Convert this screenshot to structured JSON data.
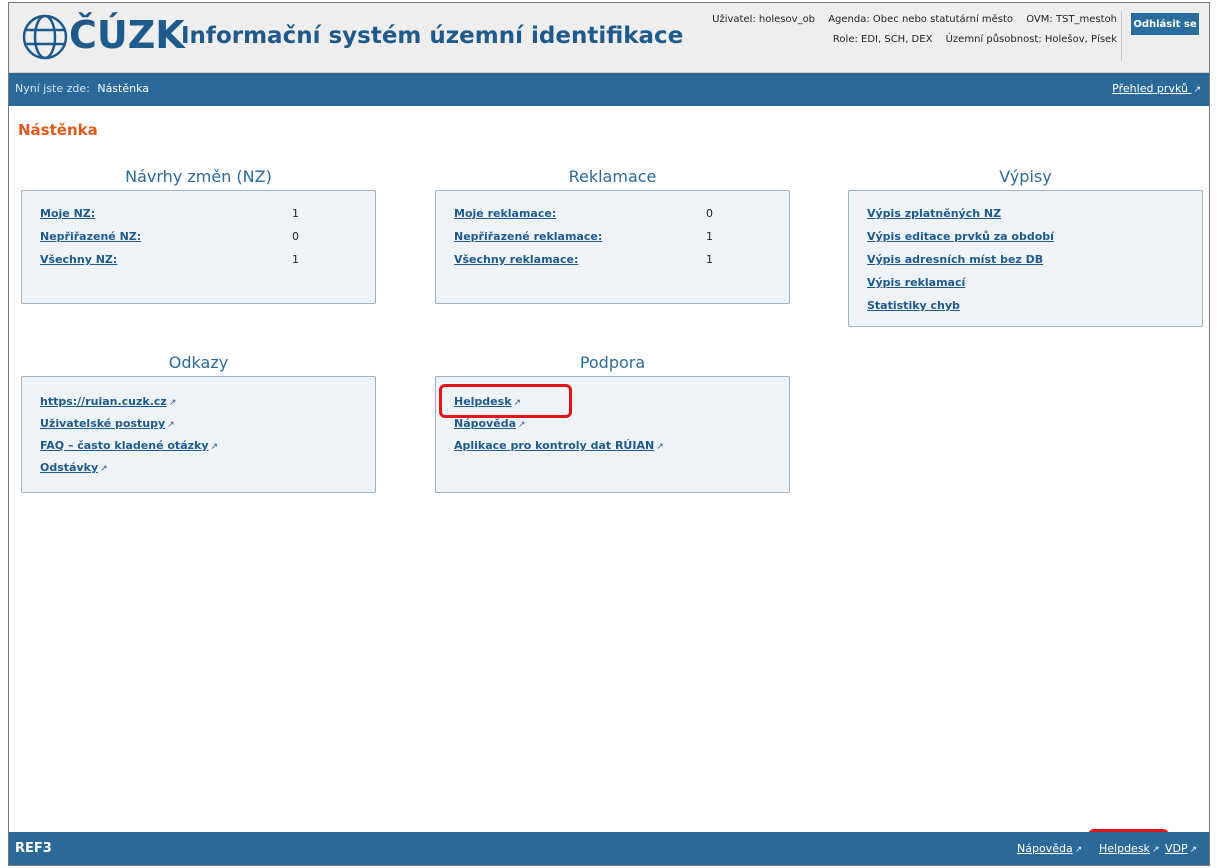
{
  "header": {
    "logo_text": "ČÚZK",
    "app_title": "Informační systém územní identifikace",
    "user": "Uživatel: holesov_ob",
    "agenda": "Agenda: Obec nebo statutární město",
    "ovm": "OVM: TST_mestoh",
    "role": "Role: EDI, SCH, DEX",
    "territory": "Územní působnost: Holešov, Písek",
    "logout_label": "Odhlásit se"
  },
  "nav": {
    "crumb_label": "Nyní jste zde:",
    "crumb_current": "Nástěnka",
    "overview_label": "Přehled prvků"
  },
  "page_title": "Nástěnka",
  "proposals": {
    "title": "Návrhy změn (NZ)",
    "rows": [
      {
        "label": "Moje NZ:",
        "count": "1"
      },
      {
        "label": "Nepřiřazené NZ:",
        "count": "0"
      },
      {
        "label": "Všechny NZ:",
        "count": "1"
      }
    ]
  },
  "claims": {
    "title": "Reklamace",
    "rows": [
      {
        "label": "Moje reklamace:",
        "count": "0"
      },
      {
        "label": "Nepřiřazené reklamace:",
        "count": "1"
      },
      {
        "label": "Všechny reklamace:",
        "count": "1"
      }
    ]
  },
  "reports": {
    "title": "Výpisy",
    "items": [
      "Výpis zplatněných NZ",
      "Výpis editace prvků za období",
      "Výpis adresních míst bez DB",
      "Výpis reklamací",
      "Statistiky chyb"
    ]
  },
  "links": {
    "title": "Odkazy",
    "items": [
      "https://ruian.cuzk.cz",
      "Uživatelské postupy",
      "FAQ – často kladené otázky",
      "Odstávky"
    ]
  },
  "support": {
    "title": "Podpora",
    "items": [
      "Helpdesk",
      "Nápověda",
      "Aplikace pro kontroly dat RÚIAN"
    ]
  },
  "footer": {
    "ref": "REF3",
    "help_label": "Nápověda",
    "helpdesk_label": "Helpdesk",
    "vdp_label": "VDP"
  },
  "colors": {
    "brand_blue": "#2b6a98",
    "title_orange": "#e05a1d",
    "highlight_red": "#e4141c"
  }
}
